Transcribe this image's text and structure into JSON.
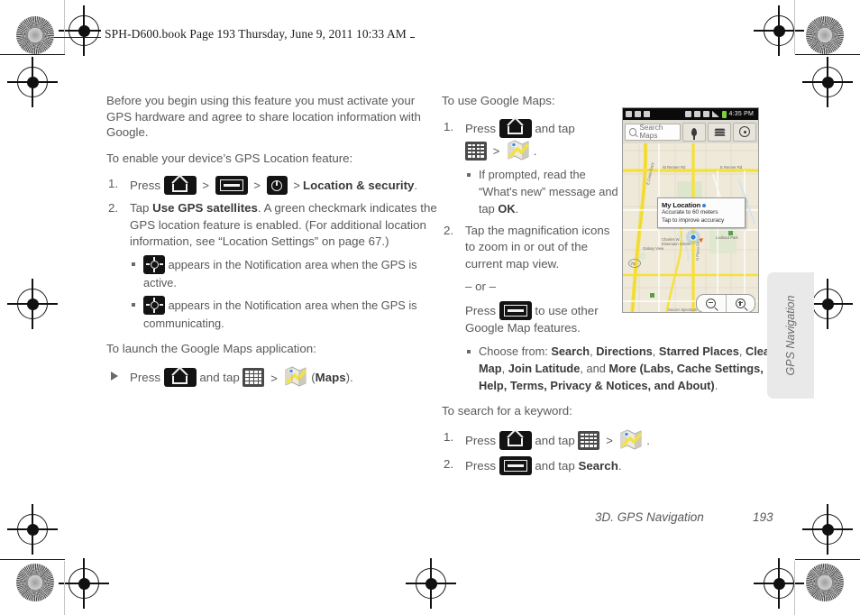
{
  "header": {
    "text": "SPH-D600.book  Page 193  Thursday, June 9, 2011  10:33 AM"
  },
  "left_column": {
    "intro": "Before you begin using this feature you must activate your GPS hardware and agree to share location information with Google.",
    "enable_heading": "To enable your device’s GPS Location feature:",
    "step1": {
      "press": "Press",
      "gt": ">",
      "target": "Location & security",
      "period": "."
    },
    "step2": {
      "lead": "Tap ",
      "bold": "Use GPS satellites",
      "rest": ". A green checkmark indicates the GPS location feature is enabled. (For additional location information, see “Location Settings” on page 67.)"
    },
    "bullet_active": "appears in the Notification area when the GPS is active.",
    "bullet_comm": "appears in the Notification area when the GPS is communicating.",
    "launch_heading": "To launch the Google Maps application:",
    "launch_step": {
      "press": "Press",
      "and_tap": "and tap",
      "gt": ">",
      "maps_open": "(",
      "maps_bold": "Maps",
      "maps_close": ")."
    }
  },
  "right_column": {
    "use_heading": "To use Google Maps:",
    "step1": {
      "press": "Press",
      "and_tap": "and tap",
      "gt": ">",
      "period": "."
    },
    "step1_bullet": "If prompted, read the “What's new” message and tap ",
    "step1_bullet_bold": "OK",
    "step1_bullet_end": ".",
    "step2": {
      "text": "Tap the magnification icons to zoom in or out of the current map view.",
      "or": "– or –",
      "press": "Press",
      "suffix": "to use other Google Map features."
    },
    "choose_bullet": {
      "lead": "Choose from: ",
      "b1": "Search",
      "s1": ", ",
      "b2": "Directions",
      "s2": ", ",
      "b3": "Starred Places",
      "s3": ", ",
      "b4": "Clear Map",
      "s4": ", ",
      "b5": "Join Latitude",
      "s5": ", and ",
      "b6": "More (Labs, Cache Settings, Help, Terms, Privacy & Notices, and About)",
      "s6": "."
    },
    "search_heading": "To search for a keyword:",
    "search_step1": {
      "press": "Press",
      "and_tap": "and tap",
      "gt": ">",
      "period": "."
    },
    "search_step2": {
      "press": "Press",
      "and_tap": "and tap ",
      "bold": "Search",
      "period": "."
    }
  },
  "device_screenshot": {
    "status_bar": {
      "clock": "4:35 PM"
    },
    "search_placeholder": "Search Maps",
    "toolbar_icons": [
      "place-pin-icon",
      "layers-icon",
      "directions-icon"
    ],
    "callout": {
      "title": "My Location",
      "line1": "Accurate to 60 meters",
      "line2": "Tap to improve accuracy"
    },
    "map_labels": [
      "E Crisis Expy",
      "W Renner Rd",
      "E Renner Rd",
      "Lookout Park",
      "Charles W. Eisemann Center",
      "N Glenville Dr",
      "N Plano Rd",
      "Galaxy View",
      "Soccer Spectrum",
      "75"
    ],
    "zoom_controls": [
      "zoom-out-icon",
      "zoom-in-icon"
    ]
  },
  "side_tab": {
    "label": "GPS Navigation"
  },
  "footer": {
    "section": "3D. GPS Navigation",
    "page": "193"
  }
}
